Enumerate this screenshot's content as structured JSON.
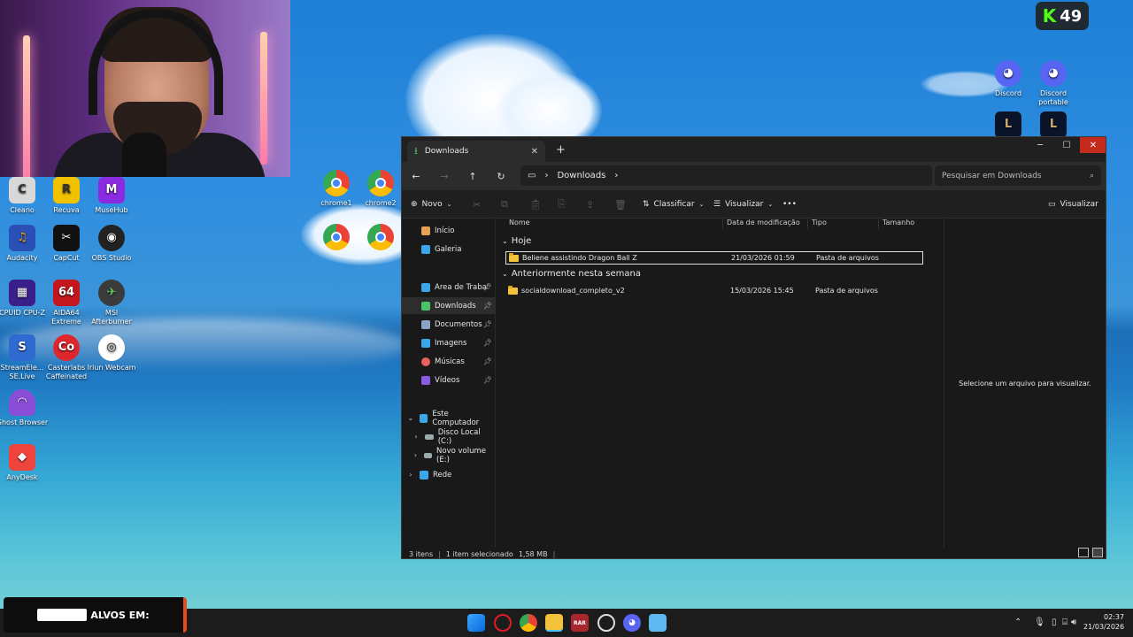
{
  "stream_badge": {
    "count": "49",
    "icon": "kick-icon"
  },
  "desktop_icons": [
    {
      "label": "Cleano",
      "icon": "cleano-icon",
      "color": "#e0e0e0"
    },
    {
      "label": "Recuva",
      "icon": "recuva-icon",
      "color": "#f2c200"
    },
    {
      "label": "MuseHub",
      "icon": "musehub-icon",
      "color": "#8a2be2"
    },
    {
      "label": "Audacity",
      "icon": "audacity-icon",
      "color": "#f2a400"
    },
    {
      "label": "CapCut",
      "icon": "capcut-icon",
      "color": "#111111"
    },
    {
      "label": "OBS Studio",
      "icon": "obs-icon",
      "color": "#222222"
    },
    {
      "label": "CPUID CPU-Z",
      "icon": "cpuz-icon",
      "color": "#3a1f8a"
    },
    {
      "label": "AIDA64 Extreme",
      "icon": "aida64-icon",
      "color": "#c4161c"
    },
    {
      "label": "MSI Afterburner",
      "icon": "msi-icon",
      "color": "#3b3b3b"
    },
    {
      "label": "StreamEle... SE.Live",
      "icon": "streamelements-icon",
      "color": "#2f6ad0"
    },
    {
      "label": "Casterlabs Caffeinated",
      "icon": "casterlabs-icon",
      "color": "#e0262d"
    },
    {
      "label": "Iriun Webcam",
      "icon": "iriun-icon",
      "color": "#ffffff"
    },
    {
      "label": "Ghost Browser",
      "icon": "ghost-browser-icon",
      "color": "#8a4dd8"
    },
    {
      "label": "AnyDesk",
      "icon": "anydesk-icon",
      "color": "#ef443b"
    },
    {
      "label": "chrome1",
      "icon": "chrome-icon",
      "color": "#4285f4"
    },
    {
      "label": "chrome2",
      "icon": "chrome-icon",
      "color": "#4285f4"
    },
    {
      "label": "Discord",
      "icon": "discord-icon",
      "color": "#5865f2"
    },
    {
      "label": "Discord portable",
      "icon": "discord-icon",
      "color": "#5865f2"
    }
  ],
  "explorer": {
    "tab_title": "Downloads",
    "breadcrumb": [
      "Downloads"
    ],
    "search_placeholder": "Pesquisar em Downloads",
    "toolbar": {
      "new": "Novo",
      "sort": "Classificar",
      "view": "Visualizar",
      "more": "•••",
      "details": "Visualizar"
    },
    "sidebar": [
      {
        "label": "Início",
        "icon": "home-icon",
        "color": "#e8a055"
      },
      {
        "label": "Galeria",
        "icon": "gallery-icon",
        "color": "#3ca7e8"
      },
      {
        "label": "Área de Trabalho",
        "icon": "desktop-icon",
        "color": "#3ca7e8",
        "pinned": true
      },
      {
        "label": "Downloads",
        "icon": "download-icon",
        "color": "#4cc36a",
        "pinned": true,
        "selected": true
      },
      {
        "label": "Documentos",
        "icon": "documents-icon",
        "color": "#8aa4c8",
        "pinned": true
      },
      {
        "label": "Imagens",
        "icon": "pictures-icon",
        "color": "#3ca7e8",
        "pinned": true
      },
      {
        "label": "Músicas",
        "icon": "music-icon",
        "color": "#e86060",
        "pinned": true
      },
      {
        "label": "Vídeos",
        "icon": "videos-icon",
        "color": "#8a5ae0",
        "pinned": true
      },
      {
        "label": "Este Computador",
        "icon": "computer-icon",
        "color": "#3ca7e8"
      },
      {
        "label": "Disco Local (C:)",
        "icon": "drive-icon",
        "color": "#9aa"
      },
      {
        "label": "Novo volume (E:)",
        "icon": "drive-icon",
        "color": "#9aa"
      },
      {
        "label": "Rede",
        "icon": "network-icon",
        "color": "#3ca7e8"
      }
    ],
    "columns": [
      "Nome",
      "Data de modificação",
      "Tipo",
      "Tamanho"
    ],
    "groups": [
      {
        "title": "Hoje",
        "files": [
          {
            "name": "Beliene assistindo Dragon Ball Z",
            "date": "21/03/2026 01:59",
            "type": "Pasta de arquivos",
            "size": ""
          }
        ]
      },
      {
        "title": "Anteriormente nesta semana",
        "files": [
          {
            "name": "socialdownload_completo_v2",
            "date": "15/03/2026 15:45",
            "type": "Pasta de arquivos",
            "size": ""
          }
        ]
      }
    ],
    "preview_text": "Selecione um arquivo para visualizar.",
    "status": {
      "items": "3 itens",
      "selected": "1 item selecionado",
      "size": "1,58 MB"
    }
  },
  "overlay_text": "ALVOS EM:",
  "taskbar": {
    "icons": [
      "windows-start-icon",
      "opera-icon",
      "chrome-icon",
      "file-explorer-icon",
      "winrar-icon",
      "github-desktop-icon",
      "discord-icon",
      "notepad-icon"
    ],
    "time": "02:37",
    "date": "21/03/2026"
  }
}
